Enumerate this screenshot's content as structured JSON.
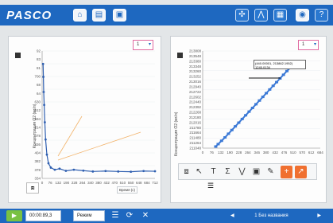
{
  "app": {
    "logo": "PASCO"
  },
  "toolbar_left": [
    {
      "icon": "home-icon",
      "glyph": "⌂"
    },
    {
      "icon": "document-icon",
      "glyph": "▤"
    },
    {
      "icon": "new-file-icon",
      "glyph": "▣"
    }
  ],
  "toolbar_right": [
    {
      "icon": "sensor-icon",
      "glyph": "✣"
    },
    {
      "icon": "share-icon",
      "glyph": "⋀"
    },
    {
      "icon": "data-icon",
      "glyph": "▦"
    },
    {
      "icon": "camera-icon",
      "glyph": "◉"
    },
    {
      "icon": "help-icon",
      "glyph": "?"
    }
  ],
  "left_panel": {
    "selector": "1",
    "ylabel": "Концентрация O2 (мг/л)",
    "ytick_labels": [
      "92",
      "83",
      "81",
      "700",
      "68",
      "64",
      "630",
      "612",
      "594",
      "514",
      "478",
      "436",
      "404",
      "382",
      "378",
      "334"
    ],
    "xtick_labels": [
      "0",
      "76",
      "132",
      "190",
      "228",
      "264",
      "340",
      "380",
      "432",
      "470",
      "510",
      "550",
      "648",
      "684",
      "712"
    ],
    "x_unit": "Время (с)",
    "chart_data": {
      "type": "scatter",
      "x": [
        6,
        8,
        10,
        13,
        17,
        22,
        30,
        40,
        55,
        80,
        110,
        150,
        200,
        260,
        320,
        400,
        480,
        560,
        640,
        712
      ],
      "y": [
        89,
        83,
        76,
        70,
        62,
        54,
        47,
        43,
        41,
        40,
        40.5,
        39.5,
        40,
        39.6,
        39.2,
        39.4,
        39.2,
        39.1,
        39.4,
        39.3
      ],
      "ylim": [
        36,
        95
      ],
      "xlim": [
        0,
        712
      ]
    }
  },
  "right_panel": {
    "selector": "1",
    "ylabel": "Концентрация O2 (мг/л)",
    "tooltip": "(440.00001, 213862.1952) 1245.0134",
    "ytick_labels": [
      "213808",
      "213548",
      "213380",
      "213348",
      "213260",
      "213252",
      "213016",
      "212940",
      "212722",
      "212602",
      "212440",
      "212392",
      "212268",
      "212180",
      "212016",
      "211780",
      "211664",
      "211480",
      "211264",
      "211048"
    ],
    "xtick_labels": [
      "0",
      "76",
      "132",
      "190",
      "228",
      "264",
      "346",
      "380",
      "432",
      "476",
      "510",
      "570",
      "612",
      "684"
    ],
    "chart_data": {
      "type": "scatter",
      "x": [
        76,
        90,
        110,
        130,
        150,
        170,
        190,
        210,
        230,
        250,
        270,
        290,
        310,
        330,
        350,
        370,
        390,
        410,
        430,
        450,
        470,
        490,
        510,
        540
      ],
      "y": [
        211048,
        211120,
        211220,
        211320,
        211430,
        211540,
        211650,
        211760,
        211870,
        211980,
        212090,
        212200,
        212310,
        212420,
        212530,
        212640,
        212750,
        212860,
        212970,
        213080,
        213190,
        213300,
        213400,
        213520
      ],
      "xlim": [
        0,
        684
      ],
      "ylim": [
        211000,
        213900
      ]
    }
  },
  "palette": [
    {
      "icon": "graph-type-icon",
      "glyph": "⧈"
    },
    {
      "icon": "select-icon",
      "glyph": "↖"
    },
    {
      "icon": "text-tool-icon",
      "glyph": "T"
    },
    {
      "icon": "sum-icon",
      "glyph": "Σ"
    },
    {
      "icon": "fit-icon",
      "glyph": "⋁"
    },
    {
      "icon": "zoom-icon",
      "glyph": "▣"
    },
    {
      "icon": "brush-icon",
      "glyph": "✎"
    },
    {
      "icon": "coordinate-tool-icon",
      "glyph": "+"
    },
    {
      "icon": "slope-tool-icon",
      "glyph": "↗"
    }
  ],
  "bottom": {
    "timer": "00:00:89,3",
    "mode": "Режим",
    "pager": "1 Без названия"
  }
}
